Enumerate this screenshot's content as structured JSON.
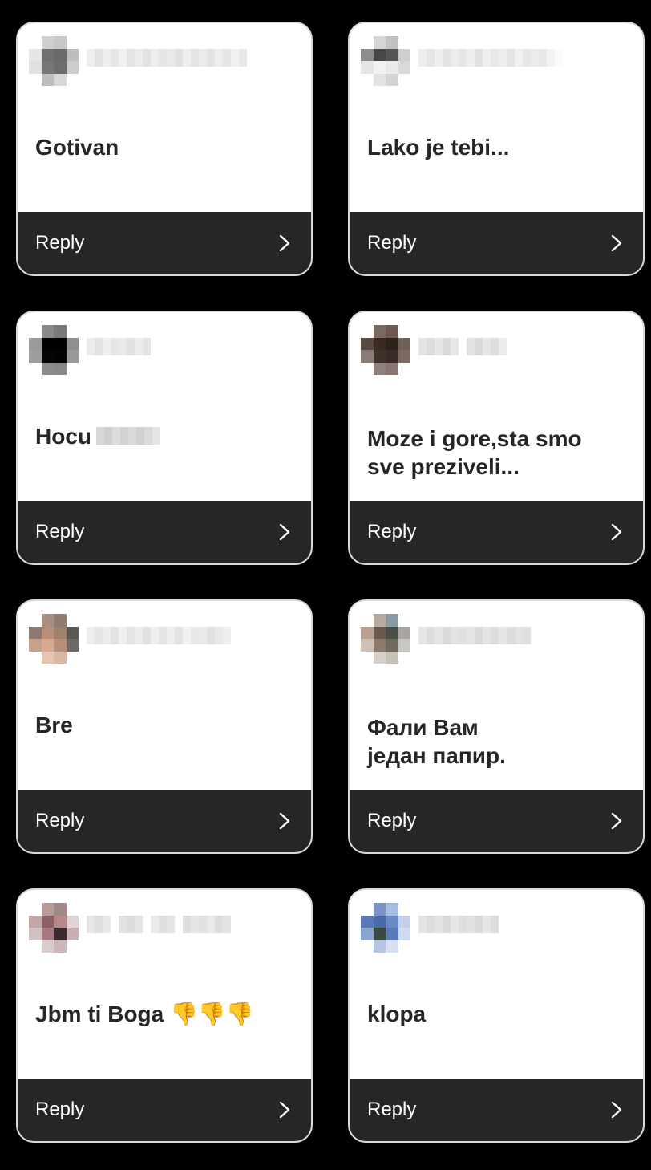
{
  "cards": [
    {
      "message": "Gotivan",
      "reply_label": "Reply",
      "icon": "chevron-right-icon",
      "avatar_colors": [
        "#ffffff",
        "#cfcfcf",
        "#c8c8c8",
        "#ffffff",
        "#e6e6e6",
        "#707070",
        "#6a6a6a",
        "#bdbdbd",
        "#e0e0e0",
        "#777777",
        "#6d6d6d",
        "#cccccc",
        "#ffffff",
        "#bdbdbd",
        "#d8d8d8",
        "#ffffff"
      ],
      "username_colors": [
        "#efefef",
        "#e3e3e3",
        "#eeeeee",
        "#e6e6e6",
        "#f0f0f0",
        "#e4e4e4",
        "#ececec",
        "#e2e2e2",
        "#eeeeee",
        "#e6e6e6",
        "#e9e9e9",
        "#e1e1e1",
        "#efefef",
        "#e5e5e5",
        "#ebebeb",
        "#e3e3e3",
        "#eeeeee",
        "#e6e6e6",
        "#f1f1f1",
        "#e8e8e8"
      ]
    },
    {
      "message": "Lako je tebi...",
      "reply_label": "Reply",
      "icon": "chevron-right-icon",
      "avatar_colors": [
        "#ffffff",
        "#d6d6d6",
        "#c2c2c2",
        "#ffffff",
        "#8d8d8d",
        "#474747",
        "#565656",
        "#cfcfcf",
        "#e5e5e5",
        "#f2f2f2",
        "#e9e9e9",
        "#d9d9d9",
        "#ffffff",
        "#e2e2e2",
        "#d4d4d4",
        "#ffffff"
      ],
      "username_colors": [
        "#ededed",
        "#e5e5e5",
        "#efefef",
        "#e3e3e3",
        "#ebebeb",
        "#e6e6e6",
        "#eeeeee",
        "#e1e1e1",
        "#efefef",
        "#e7e7e7",
        "#ededed",
        "#e4e4e4",
        "#f0f0f0",
        "#e6e6e6",
        "#ececec",
        "#e8e8e8",
        "#f2f2f2",
        "#fafafa"
      ]
    },
    {
      "message": "Hocu",
      "reply_label": "Reply",
      "icon": "chevron-right-icon",
      "avatar_colors": [
        "#ffffff",
        "#8a8a8a",
        "#7a7a7a",
        "#ffffff",
        "#9a9a9a",
        "#000000",
        "#000000",
        "#8f8f8f",
        "#9e9e9e",
        "#050505",
        "#030303",
        "#999999",
        "#ffffff",
        "#8c8c8c",
        "#888888",
        "#ffffff"
      ],
      "username_colors": [
        "#ececec",
        "#e2e2e2",
        "#eeeeee",
        "#e5e5e5",
        "#e9e9e9",
        "#e1e1e1",
        "#ececec",
        "#e4e4e4"
      ],
      "inline_blur": [
        "#d8d8d8",
        "#cfcfcf",
        "#dddddd",
        "#d2d2d2",
        "#dadada",
        "#d0d0d0",
        "#d9d9d9",
        "#e4e4e4"
      ]
    },
    {
      "message": "Moze i gore,sta smo\nsve preziveli...",
      "reply_label": "Reply",
      "icon": "chevron-right-icon",
      "avatar_colors": [
        "#ffffff",
        "#7c6a60",
        "#6d5a50",
        "#ffffff",
        "#5a4840",
        "#3a2a22",
        "#2e221c",
        "#6f5f57",
        "#8a7c74",
        "#40302a",
        "#3a2c25",
        "#7a6a62",
        "#ffffff",
        "#8e807a",
        "#877770",
        "#ffffff"
      ],
      "username_colors": [
        "#e4e4e4",
        "#dcdcdc",
        "#e6e6e6",
        "#dadada",
        "#e8e8e8",
        "#ffffff",
        "#e2e2e2",
        "#d9d9d9",
        "#e5e5e5",
        "#dedede",
        "#ececec"
      ]
    },
    {
      "message": "Bre",
      "reply_label": "Reply",
      "icon": "chevron-right-icon",
      "avatar_colors": [
        "#ffffff",
        "#a68f82",
        "#8e7c72",
        "#ffffff",
        "#8a7a72",
        "#b88f78",
        "#9e8270",
        "#5a5650",
        "#c9a08c",
        "#d8a890",
        "#b88e78",
        "#6b6a66",
        "#ffffff",
        "#e6c4b2",
        "#d9b7a6",
        "#ffffff"
      ],
      "username_colors": [
        "#eeeeee",
        "#e6e6e6",
        "#ececec",
        "#e2e2e2",
        "#efefef",
        "#e5e5e5",
        "#ebebeb",
        "#e1e1e1",
        "#eeeeee",
        "#e4e4e4",
        "#ededed",
        "#e3e3e3",
        "#f1f1f1",
        "#e7e7e7",
        "#e9e9e9",
        "#e0e0e0",
        "#e8e8e8",
        "#eeeeee"
      ]
    },
    {
      "message": "Фали Вам\nједан папир.",
      "reply_label": "Reply",
      "icon": "chevron-right-icon",
      "avatar_colors": [
        "#ffffff",
        "#b8aaa0",
        "#8a9aa4",
        "#ffffff",
        "#b9a090",
        "#6a5a4c",
        "#4a4e46",
        "#a8a4a0",
        "#d0c0b4",
        "#8c7a6c",
        "#6e6a5c",
        "#c8c8c0",
        "#ffffff",
        "#d8d0c8",
        "#c6c2ba",
        "#ffffff"
      ],
      "username_colors": [
        "#e6e6e6",
        "#dcdcdc",
        "#e4e4e4",
        "#dadada",
        "#e2e2e2",
        "#e0e0e0",
        "#e5e5e5",
        "#d9d9d9",
        "#e3e3e3",
        "#dddddd",
        "#e6e6e6",
        "#dbdbdb",
        "#e2e2e2",
        "#dfdfdf"
      ]
    },
    {
      "message": "Jbm ti Boga 👎👎👎",
      "reply_label": "Reply",
      "icon": "chevron-right-icon",
      "avatar_colors": [
        "#ffffff",
        "#b89a96",
        "#a08886",
        "#ffffff",
        "#c4a6a6",
        "#8a6066",
        "#b88888",
        "#e0d4d4",
        "#d2c0c0",
        "#a87880",
        "#3a2a30",
        "#c8b0b2",
        "#ffffff",
        "#d8cccc",
        "#cab8b8",
        "#ffffff"
      ],
      "username_colors": [
        "#e6e6e6",
        "#dedede",
        "#e8e8e8",
        "#ffffff",
        "#e2e2e2",
        "#dcdcdc",
        "#e4e4e4",
        "#ffffff",
        "#e9e9e9",
        "#dfdfdf",
        "#e5e5e5",
        "#ffffff",
        "#dddddd",
        "#e6e6e6",
        "#e1e1e1",
        "#e8e8e8",
        "#dcdcdc",
        "#e3e3e3"
      ]
    },
    {
      "message": "klopa",
      "reply_label": "Reply",
      "icon": "chevron-right-icon",
      "avatar_colors": [
        "#ffffff",
        "#7a94c8",
        "#a8bce0",
        "#ffffff",
        "#5878b8",
        "#4a6aa8",
        "#6888c8",
        "#c4d0ea",
        "#8aa4d0",
        "#3a4a40",
        "#5a7ab8",
        "#d0daee",
        "#ffffff",
        "#b4c4e2",
        "#d8e0f0",
        "#ffffff"
      ],
      "username_colors": [
        "#e4e4e4",
        "#dcdcdc",
        "#e2e2e2",
        "#dadada",
        "#e6e6e6",
        "#dedede",
        "#e1e1e1",
        "#d9d9d9",
        "#e5e5e5",
        "#dddddd"
      ]
    }
  ]
}
